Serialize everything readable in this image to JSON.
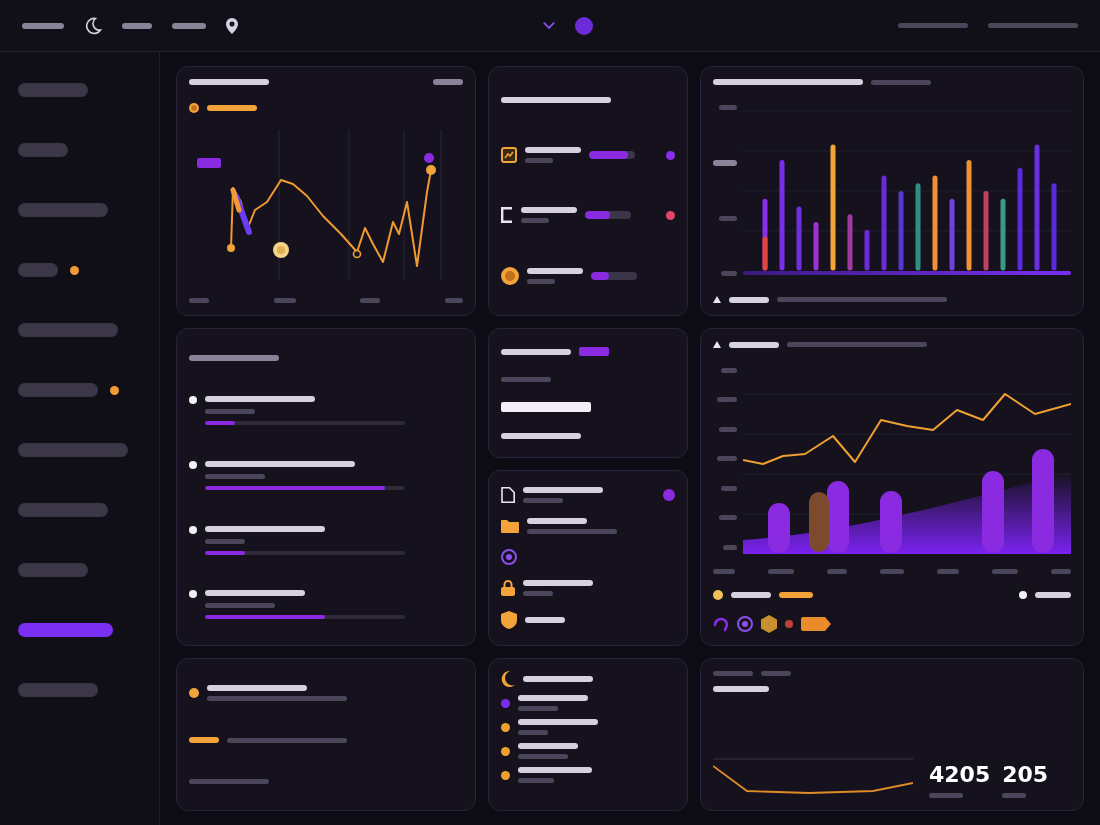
{
  "sidebar": {
    "items": [
      {
        "selected": false
      },
      {
        "selected": false
      },
      {
        "selected": false
      },
      {
        "selected": false,
        "color": "#f29a38"
      },
      {
        "selected": false
      },
      {
        "selected": false,
        "color": "#f29a38"
      },
      {
        "selected": false
      },
      {
        "selected": false
      },
      {
        "selected": false
      },
      {
        "selected": true
      },
      {
        "selected": false
      }
    ]
  },
  "token_list": {
    "rows": [
      {
        "level": 0.85,
        "color": "#8b2cf0"
      },
      {
        "level": 0.55,
        "color": "#e0456a"
      },
      {
        "level": 0.4
      }
    ]
  },
  "progress_list": {
    "rows": [
      {
        "level": 0.15
      },
      {
        "level": 0.9
      },
      {
        "level": 0.2
      },
      {
        "level": 0.6
      }
    ]
  },
  "activity_list": {
    "rows": [
      {
        "color": "#7b2cf0"
      },
      {
        "color": "#f0a030"
      },
      {
        "color": "#f0a030"
      },
      {
        "color": "#f0a030"
      }
    ]
  },
  "stats": [
    {
      "value": "4205"
    },
    {
      "value": "205"
    }
  ]
}
